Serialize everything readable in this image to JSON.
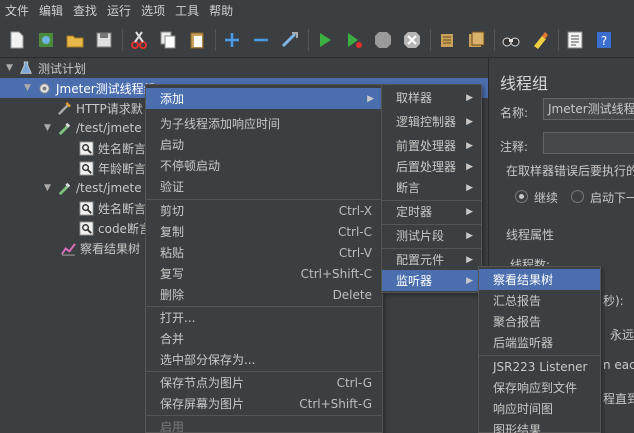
{
  "menubar": [
    "文件",
    "编辑",
    "查找",
    "运行",
    "选项",
    "工具",
    "帮助"
  ],
  "tree": {
    "root": "测试计划",
    "thread_group": "Jmeter测试线程组",
    "http": "HTTP请求默",
    "sampler1": "/test/jmete",
    "assert1": "姓名断言",
    "assert2": "年龄断言",
    "sampler2": "/test/jmete",
    "assert3": "姓名断言",
    "assert4": "code断言",
    "listener": "察看结果树"
  },
  "right_panel": {
    "title": "线程组",
    "name_label": "名称:",
    "name_value": "Jmeter测试线程组",
    "comment_label": "注释:",
    "error_label": "在取样器错误后要执行的",
    "opt_continue": "继续",
    "opt_next": "启动下一",
    "props_title": "线程属性",
    "threads_label": "线程数:",
    "rampup_fragment": "秒):",
    "forever": "永远",
    "each": "n each",
    "delay": "程直到需"
  },
  "context_menu": {
    "add": "添加",
    "add_timer": "为子线程添加响应时间",
    "start": "启动",
    "start_no_pause": "不停顿启动",
    "validate": "验证",
    "cut": "剪切",
    "cut_key": "Ctrl-X",
    "copy": "复制",
    "copy_key": "Ctrl-C",
    "paste": "粘贴",
    "paste_key": "Ctrl-V",
    "duplicate": "复写",
    "duplicate_key": "Ctrl+Shift-C",
    "delete": "删除",
    "delete_key": "Delete",
    "open": "打开...",
    "merge": "合并",
    "save_selection": "选中部分保存为...",
    "save_node_img": "保存节点为图片",
    "save_node_img_key": "Ctrl-G",
    "save_screen_img": "保存屏幕为图片",
    "save_screen_img_key": "Ctrl+Shift-G",
    "enable": "启用"
  },
  "add_submenu": [
    "取样器",
    "逻辑控制器",
    "前置处理器",
    "后置处理器",
    "断言",
    "定时器",
    "测试片段",
    "配置元件",
    "监听器"
  ],
  "listener_submenu": [
    "察看结果树",
    "汇总报告",
    "聚合报告",
    "后端监听器",
    "JSR223 Listener",
    "保存响应到文件",
    "响应时间图",
    "图形结果"
  ]
}
